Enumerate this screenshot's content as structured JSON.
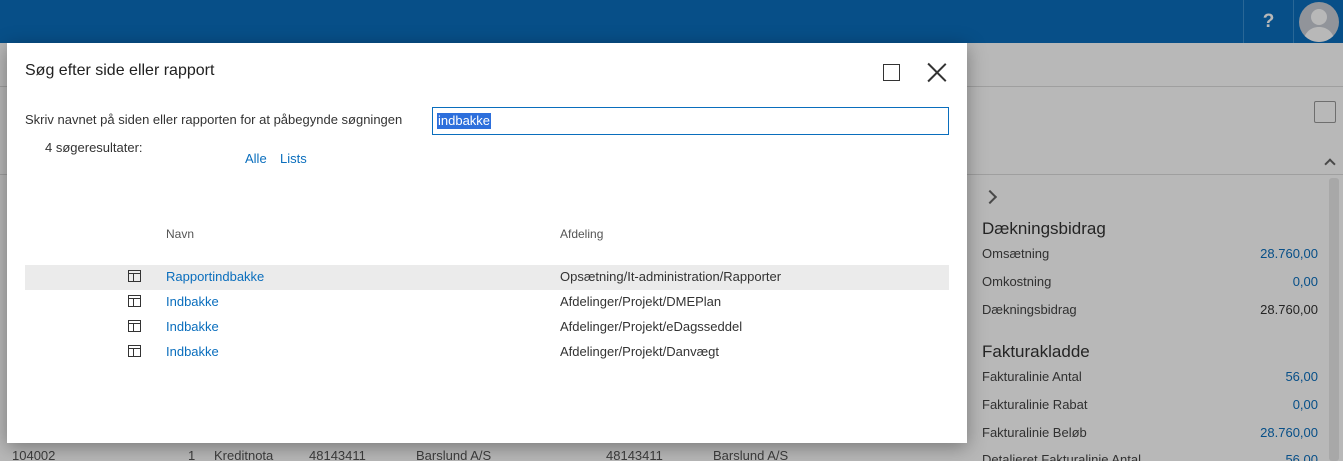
{
  "topbar": {
    "help_label": "?"
  },
  "background": {
    "factbox": {
      "section1_title": "Dækningsbidrag",
      "section1_rows": [
        {
          "label": "Omsætning",
          "value": "28.760,00",
          "link": true
        },
        {
          "label": "Omkostning",
          "value": "0,00",
          "link": true
        },
        {
          "label": "Dækningsbidrag",
          "value": "28.760,00",
          "link": false
        }
      ],
      "section2_title": "Fakturakladde",
      "section2_rows": [
        {
          "label": "Fakturalinie Antal",
          "value": "56,00",
          "link": true
        },
        {
          "label": "Fakturalinie Rabat",
          "value": "0,00",
          "link": true
        },
        {
          "label": "Fakturalinie Beløb",
          "value": "28.760,00",
          "link": true
        },
        {
          "label": "Detaljeret Fakturalinie Antal",
          "value": "56,00",
          "link": true
        }
      ]
    },
    "bottom_row": [
      "104002",
      "1",
      "Kreditnota",
      "48143411",
      "Barslund A/S",
      "48143411",
      "Barslund A/S"
    ]
  },
  "dialog": {
    "title": "Søg efter side eller rapport",
    "prompt": "Skriv navnet på siden eller rapporten for at påbegynde søgningen",
    "search_value": "indbakke",
    "result_count": "4 søgeresultater:",
    "filters": [
      "Alle",
      "Lists"
    ],
    "columns": {
      "name": "Navn",
      "department": "Afdeling"
    },
    "results": [
      {
        "name": "Rapportindbakke",
        "department": "Opsætning/It-administration/Rapporter"
      },
      {
        "name": "Indbakke",
        "department": "Afdelinger/Projekt/DMEPlan"
      },
      {
        "name": "Indbakke",
        "department": "Afdelinger/Projekt/eDagsseddel"
      },
      {
        "name": "Indbakke",
        "department": "Afdelinger/Projekt/Danvægt"
      }
    ],
    "icons": {
      "maximize": "maximize-icon",
      "close": "close-icon",
      "result": "list-page-icon"
    }
  },
  "colors": {
    "brand": "#0a6ebd",
    "link": "#0a6ebd",
    "selection": "#2d6fdc"
  }
}
